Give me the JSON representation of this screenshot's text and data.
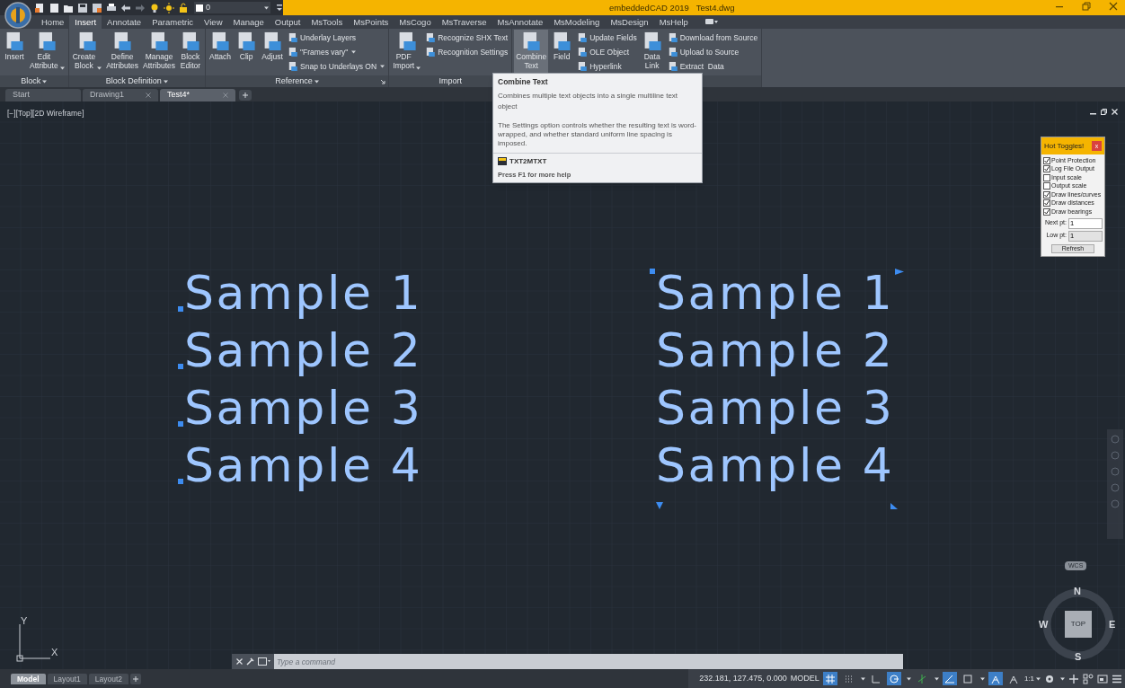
{
  "title_bar": {
    "app": "embeddedCAD 2019",
    "file": "Test4.dwg",
    "layer": "0"
  },
  "ribbon_tabs": [
    {
      "label": "Home",
      "selected": false
    },
    {
      "label": "Insert",
      "selected": true
    },
    {
      "label": "Annotate",
      "selected": false
    },
    {
      "label": "Parametric",
      "selected": false
    },
    {
      "label": "View",
      "selected": false
    },
    {
      "label": "Manage",
      "selected": false
    },
    {
      "label": "Output",
      "selected": false
    },
    {
      "label": "MsTools",
      "selected": false
    },
    {
      "label": "MsPoints",
      "selected": false
    },
    {
      "label": "MsCogo",
      "selected": false
    },
    {
      "label": "MsTraverse",
      "selected": false
    },
    {
      "label": "MsAnnotate",
      "selected": false
    },
    {
      "label": "MsModeling",
      "selected": false
    },
    {
      "label": "MsDesign",
      "selected": false
    },
    {
      "label": "MsHelp",
      "selected": false
    }
  ],
  "ribbon_panels": [
    {
      "title": "Block",
      "title_dropdown": true,
      "launcher": false,
      "items": [
        {
          "kind": "large",
          "label": "Insert",
          "dropdown": false,
          "highlighted": false
        },
        {
          "kind": "large",
          "label": "Edit Attribute",
          "dropdown": true,
          "highlighted": false
        }
      ]
    },
    {
      "title": "Block Definition",
      "title_dropdown": true,
      "launcher": false,
      "items": [
        {
          "kind": "large",
          "label": "Create Block",
          "dropdown": true,
          "highlighted": false
        },
        {
          "kind": "large",
          "label": "Define Attributes",
          "dropdown": false,
          "highlighted": false
        },
        {
          "kind": "large",
          "label": "Manage Attributes",
          "dropdown": false,
          "highlighted": false
        },
        {
          "kind": "large",
          "label": "Block Editor",
          "dropdown": false,
          "highlighted": false
        }
      ]
    },
    {
      "title": "Reference",
      "title_dropdown": true,
      "launcher": true,
      "items": [
        {
          "kind": "large",
          "label": "Attach",
          "dropdown": false,
          "highlighted": false
        },
        {
          "kind": "large",
          "label": "Clip",
          "dropdown": false,
          "highlighted": false
        },
        {
          "kind": "large",
          "label": "Adjust",
          "dropdown": false,
          "highlighted": false
        },
        {
          "kind": "small",
          "rows": [
            {
              "label": "Underlay Layers",
              "dropdown": false
            },
            {
              "label": "\"Frames vary\"",
              "dropdown": true
            },
            {
              "label": "Snap to Underlays ON",
              "dropdown": true
            }
          ]
        }
      ]
    },
    {
      "title": "Import",
      "title_dropdown": false,
      "launcher": false,
      "items": [
        {
          "kind": "large",
          "label": "PDF Import",
          "dropdown": true,
          "highlighted": false
        },
        {
          "kind": "small",
          "rows": [
            {
              "label": "Recognize SHX Text",
              "dropdown": false
            },
            {
              "label": "Recognition Settings",
              "dropdown": false
            }
          ]
        }
      ]
    },
    {
      "items": [
        {
          "kind": "large",
          "label": "Combine Text",
          "dropdown": false,
          "highlighted": true
        },
        {
          "kind": "large",
          "label": "Field",
          "dropdown": false,
          "highlighted": false
        },
        {
          "kind": "small",
          "rows": [
            {
              "label": "Update Fields",
              "dropdown": false
            },
            {
              "label": "OLE Object",
              "dropdown": false
            },
            {
              "label": "Hyperlink",
              "dropdown": false
            }
          ]
        },
        {
          "kind": "large",
          "label": "Data Link",
          "dropdown": false,
          "highlighted": false
        },
        {
          "kind": "small",
          "rows": [
            {
              "label": "Download from Source",
              "dropdown": false
            },
            {
              "label": "Upload to Source",
              "dropdown": false
            },
            {
              "label": "Extract  Data",
              "dropdown": false
            }
          ]
        }
      ]
    }
  ],
  "tooltip": {
    "title": "Combine Text",
    "description": "Combines multiple text objects into a single multiline text object",
    "details": "The Settings option controls whether the resulting text is word-wrapped, and whether standard uniform line spacing is imposed.",
    "command": "TXT2MTXT",
    "help": "Press F1 for more help"
  },
  "document_tabs": [
    {
      "label": "Start",
      "closable": false,
      "selected": false
    },
    {
      "label": "Drawing1",
      "closable": true,
      "selected": false
    },
    {
      "label": "Test4*",
      "closable": true,
      "selected": true
    }
  ],
  "viewport": {
    "label": "[−][Top][2D Wireframe]"
  },
  "text_groups": [
    {
      "kind": "single_line",
      "selected": true,
      "lines": [
        "Sample 1",
        "Sample 2",
        "Sample 3",
        "Sample 4"
      ]
    },
    {
      "kind": "multiline",
      "selected": true,
      "lines": [
        "Sample 1",
        "Sample 2",
        "Sample 3",
        "Sample 4"
      ]
    }
  ],
  "hot_toggles": {
    "title": "Hot Toggles!",
    "close": "x",
    "options": [
      {
        "label": "Point Protection",
        "checked": true
      },
      {
        "label": "Log File Output",
        "checked": true
      },
      {
        "label": "Input scale",
        "checked": false
      },
      {
        "label": "Output scale",
        "checked": false
      },
      {
        "label": "Draw lines/curves",
        "checked": true
      },
      {
        "label": "Draw distances",
        "checked": true
      },
      {
        "label": "Draw bearings",
        "checked": true
      }
    ],
    "fields": [
      {
        "label": "Next pt:",
        "value": "1",
        "disabled": false
      },
      {
        "label": "Low pt:",
        "value": "1",
        "disabled": true
      }
    ],
    "button": "Refresh"
  },
  "viewcube": {
    "top": "TOP",
    "north": "N",
    "south": "S",
    "east": "E",
    "west": "W",
    "ucs": "WCS"
  },
  "ucs_icon": {
    "x_label": "X",
    "y_label": "Y"
  },
  "command_line": {
    "placeholder": "Type a command"
  },
  "layout_tabs": [
    {
      "label": "Model",
      "selected": true
    },
    {
      "label": "Layout1",
      "selected": false
    },
    {
      "label": "Layout2",
      "selected": false
    }
  ],
  "status_bar": {
    "coordinates": "232.181, 127.475, 0.000",
    "space": "MODEL",
    "annotation_scale": "1:1",
    "toggles": [
      {
        "kind": "grid",
        "on": true
      },
      {
        "kind": "snap",
        "on": false
      },
      {
        "kind": "ortho",
        "on": false
      },
      {
        "kind": "polar",
        "on": true
      },
      {
        "kind": "isodraft",
        "on": false
      },
      {
        "kind": "tracking",
        "on": true
      },
      {
        "kind": "osnap",
        "on": false
      },
      {
        "kind": "annovis",
        "on": true
      },
      {
        "kind": "autoscale",
        "on": false
      }
    ]
  }
}
